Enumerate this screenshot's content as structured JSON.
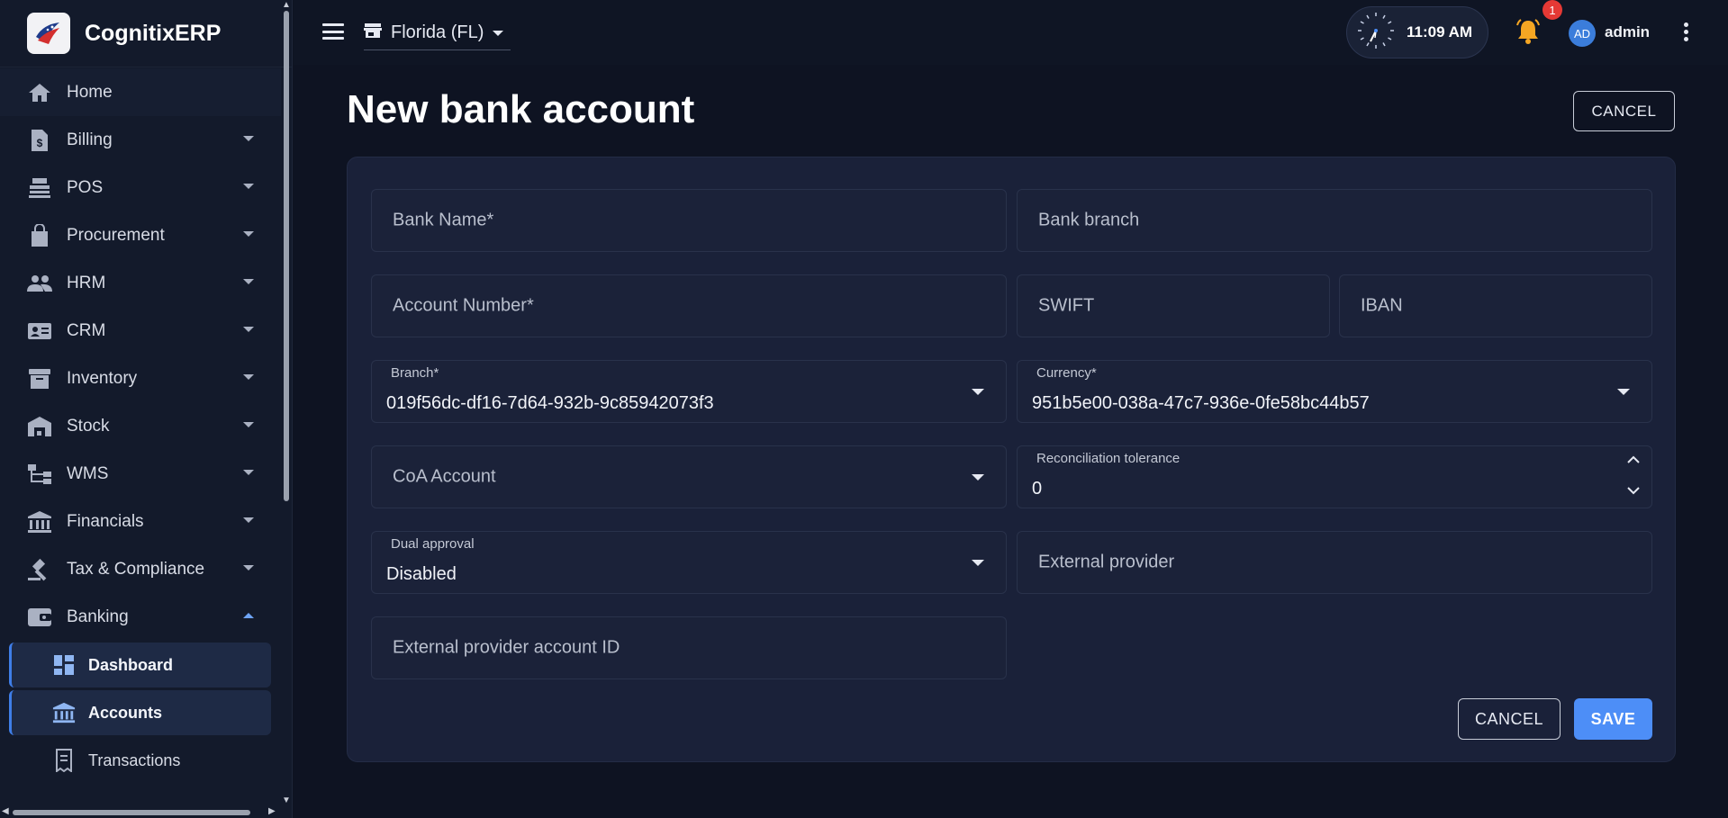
{
  "app": {
    "name": "CognitixERP"
  },
  "sidebar": {
    "items": [
      {
        "label": "Home",
        "icon": "home-icon"
      },
      {
        "label": "Billing",
        "icon": "billing-icon"
      },
      {
        "label": "POS",
        "icon": "pos-icon"
      },
      {
        "label": "Procurement",
        "icon": "shopping-bag-icon"
      },
      {
        "label": "HRM",
        "icon": "people-icon"
      },
      {
        "label": "CRM",
        "icon": "contact-card-icon"
      },
      {
        "label": "Inventory",
        "icon": "archive-box-icon"
      },
      {
        "label": "Stock",
        "icon": "warehouse-icon"
      },
      {
        "label": "WMS",
        "icon": "hierarchy-icon"
      },
      {
        "label": "Financials",
        "icon": "bank-icon"
      },
      {
        "label": "Tax & Compliance",
        "icon": "gavel-icon"
      },
      {
        "label": "Banking",
        "icon": "wallet-icon"
      }
    ],
    "banking_sub": [
      {
        "label": "Dashboard",
        "icon": "dashboard-icon"
      },
      {
        "label": "Accounts",
        "icon": "bank-icon"
      },
      {
        "label": "Transactions",
        "icon": "receipt-icon"
      }
    ]
  },
  "topbar": {
    "store": "Florida (FL)",
    "time": "11:09 AM",
    "notification_count": "1",
    "avatar_initials": "AD",
    "username": "admin"
  },
  "page": {
    "title": "New bank account",
    "cancel_top": "CANCEL",
    "cancel_bottom": "CANCEL",
    "save": "SAVE"
  },
  "form": {
    "bank_name": "Bank Name*",
    "bank_branch": "Bank branch",
    "account_number": "Account Number*",
    "swift": "SWIFT",
    "iban": "IBAN",
    "branch_label": "Branch*",
    "branch_value": "019f56dc-df16-7d64-932b-9c85942073f3",
    "currency_label": "Currency*",
    "currency_value": "951b5e00-038a-47c7-936e-0fe58bc44b57",
    "coa_account": "CoA Account",
    "reconciliation_label": "Reconciliation tolerance",
    "reconciliation_value": "0",
    "dual_approval_label": "Dual approval",
    "dual_approval_value": "Disabled",
    "external_provider": "External provider",
    "external_provider_account_id": "External provider account ID"
  },
  "colors": {
    "accent": "#4d8ef7",
    "background": "#0e1322",
    "card": "#1a2139",
    "notification": "#e53935",
    "bell": "#f5a623"
  }
}
